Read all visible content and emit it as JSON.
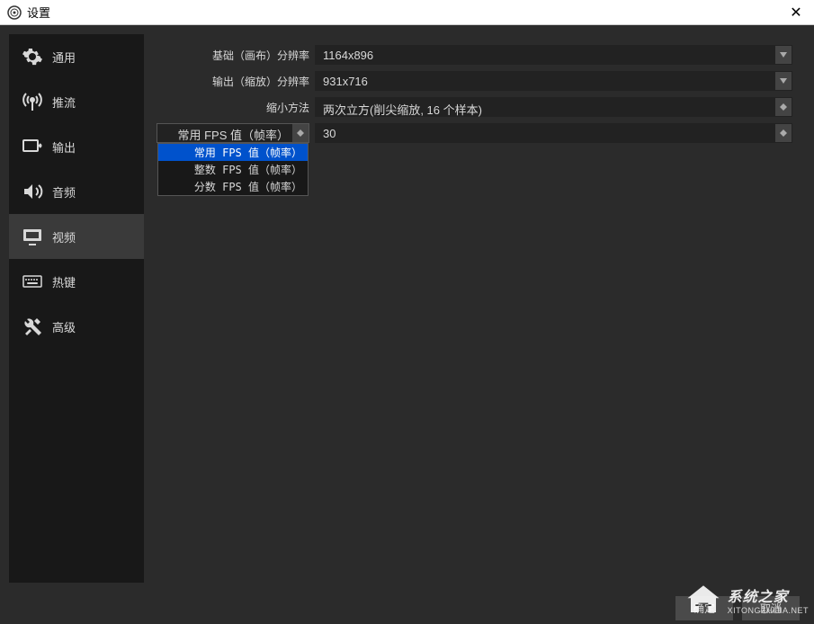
{
  "titlebar": {
    "title": "设置"
  },
  "sidebar": {
    "items": [
      {
        "label": "通用",
        "icon": "gear"
      },
      {
        "label": "推流",
        "icon": "antenna"
      },
      {
        "label": "输出",
        "icon": "output"
      },
      {
        "label": "音频",
        "icon": "speaker"
      },
      {
        "label": "视频",
        "icon": "monitor"
      },
      {
        "label": "热键",
        "icon": "keyboard"
      },
      {
        "label": "高级",
        "icon": "tools"
      }
    ]
  },
  "form": {
    "base_res_label": "基础（画布）分辨率",
    "base_res_value": "1164x896",
    "output_res_label": "输出（缩放）分辨率",
    "output_res_value": "931x716",
    "downscale_label": "缩小方法",
    "downscale_value": "两次立方(削尖缩放, 16 个样本)",
    "fps_type_label": "常用 FPS 值（帧率）",
    "fps_value": "30",
    "fps_options": [
      "常用 FPS 值（帧率）",
      "整数 FPS 值（帧率）",
      "分数 FPS 值（帧率）"
    ]
  },
  "buttons": {
    "ok": "确定",
    "cancel": "取消"
  },
  "watermark": {
    "main": "系统之家",
    "sub": "XITONGZHIJIA.NET"
  }
}
